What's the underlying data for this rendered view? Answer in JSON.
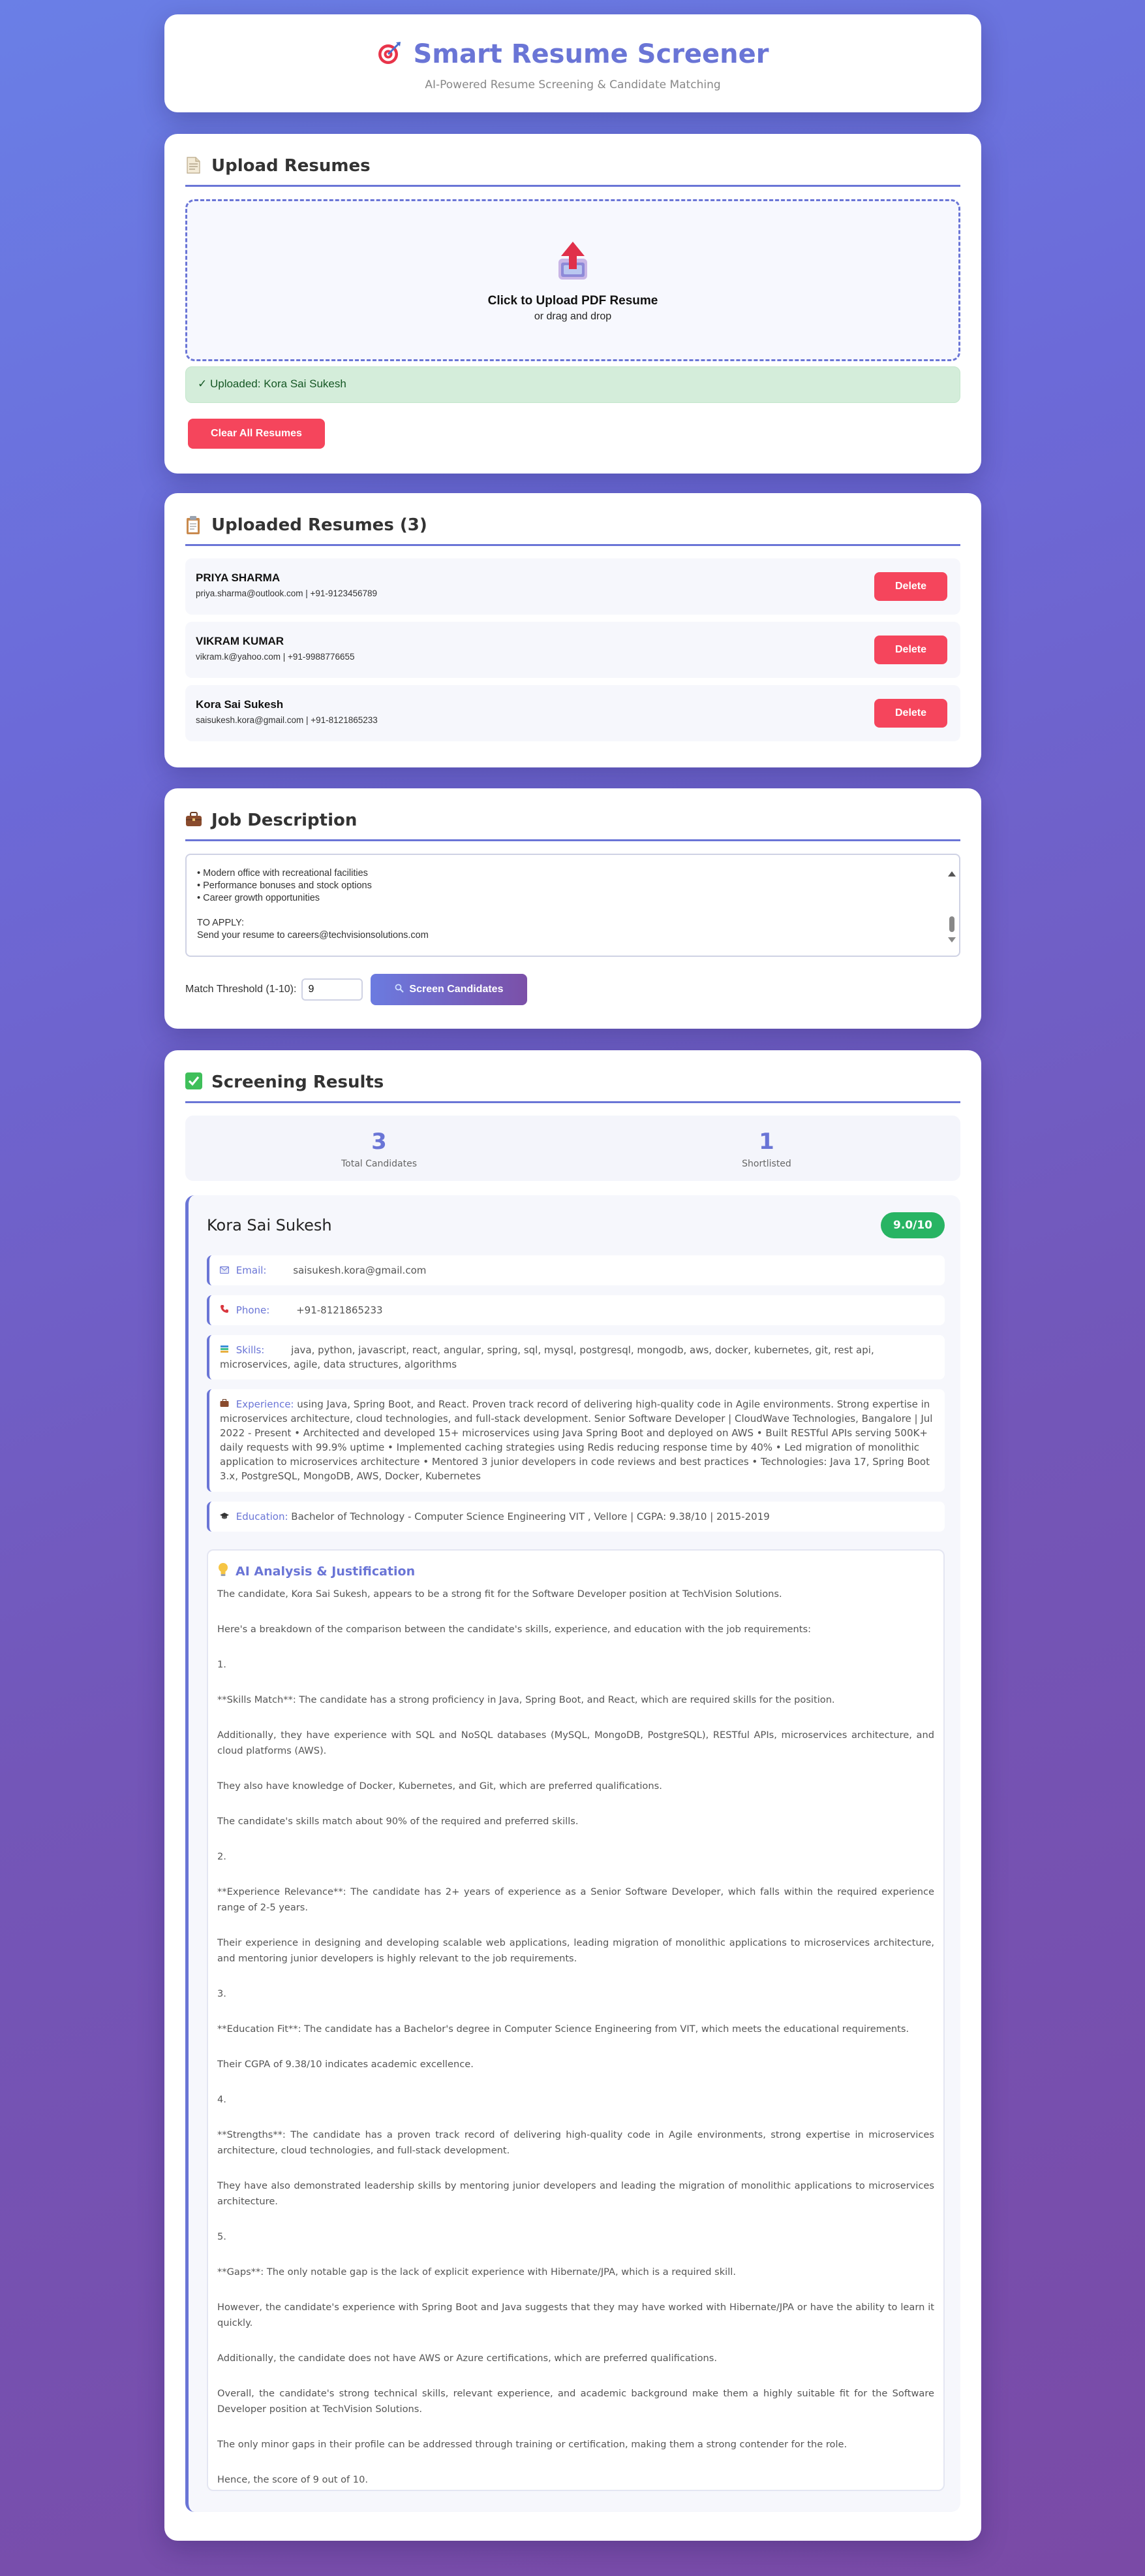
{
  "header": {
    "title": "Smart Resume Screener",
    "subtitle": "AI-Powered Resume Screening & Candidate Matching"
  },
  "upload": {
    "title": "Upload Resumes",
    "dropzone_main": "Click to Upload PDF Resume",
    "dropzone_sub": "or drag and drop",
    "status": "✓ Uploaded: Kora Sai Sukesh",
    "clear_label": "Clear All Resumes"
  },
  "resumes": {
    "title": "Uploaded Resumes (3)",
    "delete_label": "Delete",
    "items": [
      {
        "name": "PRIYA SHARMA",
        "contact": "priya.sharma@outlook.com | +91-9123456789"
      },
      {
        "name": "VIKRAM KUMAR",
        "contact": "vikram.k@yahoo.com | +91-9988776655"
      },
      {
        "name": "Kora Sai Sukesh",
        "contact": "saisukesh.kora@gmail.com | +91-8121865233"
      }
    ]
  },
  "job": {
    "title": "Job Description",
    "text": "• Modern office with recreational facilities\n• Performance bonuses and stock options\n• Career growth opportunities\n\nTO APPLY:\nSend your resume to careers@techvisionsolutions.com",
    "threshold_label": "Match Threshold (1-10):",
    "threshold_value": "9",
    "screen_label": "Screen Candidates"
  },
  "results": {
    "title": "Screening Results",
    "stats": {
      "total": "3",
      "total_label": "Total Candidates",
      "shortlisted": "1",
      "shortlisted_label": "Shortlisted"
    },
    "candidate": {
      "name": "Kora Sai Sukesh",
      "score": "9.0/10",
      "email_label": "Email:",
      "email": "saisukesh.kora@gmail.com",
      "phone_label": "Phone:",
      "phone": "+91-8121865233",
      "skills_label": "Skills:",
      "skills": "java, python, javascript, react, angular, spring, sql, mysql, postgresql, mongodb, aws, docker, kubernetes, git, rest api, microservices, agile, data structures, algorithms",
      "experience_label": "Experience:",
      "experience": "using Java, Spring Boot, and React. Proven track record of delivering high-quality code in Agile environments. Strong expertise in microservices architecture, cloud technologies, and full-stack development. Senior Software Developer | CloudWave Technologies, Bangalore | Jul 2022 - Present • Architected and developed 15+ microservices using Java Spring Boot and deployed on AWS • Built RESTful APIs serving 500K+ daily requests with 99.9% uptime • Implemented caching strategies using Redis reducing response time by 40% • Led migration of monolithic application to microservices architecture • Mentored 3 junior developers in code reviews and best practices • Technologies: Java 17, Spring Boot 3.x, PostgreSQL, MongoDB, AWS, Docker, Kubernetes",
      "education_label": "Education:",
      "education": "Bachelor of Technology - Computer Science Engineering VIT , Vellore | CGPA: 9.38/10 | 2015-2019",
      "analysis_title": "AI Analysis & Justification",
      "analysis": [
        "The candidate, Kora Sai Sukesh, appears to be a strong fit for the Software Developer position at TechVision Solutions.",
        "Here's a breakdown of the comparison between the candidate's skills, experience, and education with the job requirements:",
        "1.",
        "**Skills Match**: The candidate has a strong proficiency in Java, Spring Boot, and React, which are required skills for the position.",
        "Additionally, they have experience with SQL and NoSQL databases (MySQL, MongoDB, PostgreSQL), RESTful APIs, microservices architecture, and cloud platforms (AWS).",
        "They also have knowledge of Docker, Kubernetes, and Git, which are preferred qualifications.",
        "The candidate's skills match about 90% of the required and preferred skills.",
        "2.",
        "**Experience Relevance**: The candidate has 2+ years of experience as a Senior Software Developer, which falls within the required experience range of 2-5 years.",
        "Their experience in designing and developing scalable web applications, leading migration of monolithic applications to microservices architecture, and mentoring junior developers is highly relevant to the job requirements.",
        "3.",
        "**Education Fit**: The candidate has a Bachelor's degree in Computer Science Engineering from VIT, which meets the educational requirements.",
        "Their CGPA of 9.38/10 indicates academic excellence.",
        "4.",
        "**Strengths**: The candidate has a proven track record of delivering high-quality code in Agile environments, strong expertise in microservices architecture, cloud technologies, and full-stack development.",
        "They have also demonstrated leadership skills by mentoring junior developers and leading the migration of monolithic applications to microservices architecture.",
        "5.",
        "**Gaps**: The only notable gap is the lack of explicit experience with Hibernate/JPA, which is a required skill.",
        "However, the candidate's experience with Spring Boot and Java suggests that they may have worked with Hibernate/JPA or have the ability to learn it quickly.",
        "Additionally, the candidate does not have AWS or Azure certifications, which are preferred qualifications.",
        "Overall, the candidate's strong technical skills, relevant experience, and academic background make them a highly suitable fit for the Software Developer position at TechVision Solutions.",
        "The only minor gaps in their profile can be addressed through training or certification, making them a strong contender for the role.",
        "Hence, the score of 9 out of 10."
      ]
    }
  },
  "icons": {
    "header": "target-icon",
    "upload": "page-icon",
    "resumes": "clipboard-icon",
    "job": "briefcase-icon",
    "results": "checkmark-icon",
    "analysis": "lightbulb-icon"
  },
  "colors": {
    "accent": "#6a75d6",
    "danger": "#f5455c",
    "success": "#28b463",
    "success_bg": "#d4edda"
  }
}
